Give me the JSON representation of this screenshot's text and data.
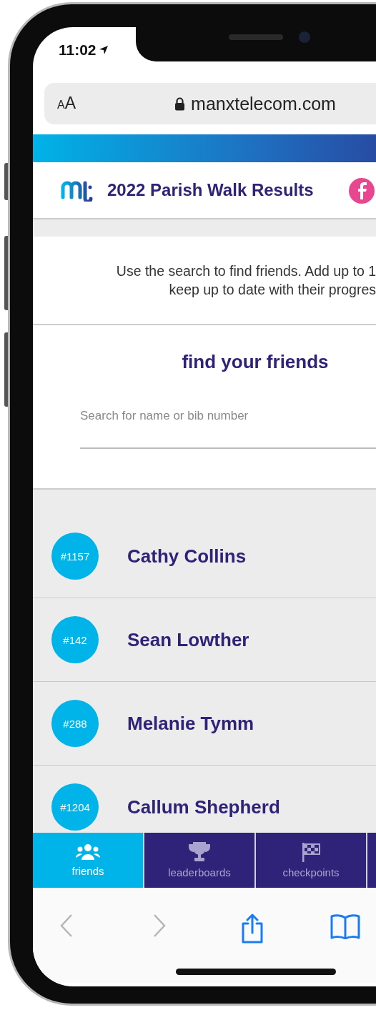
{
  "status_bar": {
    "time": "11:02"
  },
  "address_bar": {
    "text_size": "AA",
    "url": "manxtelecom.com"
  },
  "header": {
    "title": "2022 Parish Walk Results"
  },
  "intro": {
    "text": "Use the search to find friends. Add up to 1\nkeep up to date with their progres"
  },
  "search": {
    "heading": "find your friends",
    "placeholder": "Search for name or bib number"
  },
  "friends": [
    {
      "bib": "#1157",
      "name": "Cathy Collins"
    },
    {
      "bib": "#142",
      "name": "Sean Lowther"
    },
    {
      "bib": "#288",
      "name": "Melanie Tymm"
    },
    {
      "bib": "#1204",
      "name": "Callum Shepherd"
    }
  ],
  "tabs": [
    {
      "kind": "people",
      "label": "friends",
      "selected": true
    },
    {
      "kind": "trophy",
      "label": "leaderboards",
      "selected": false
    },
    {
      "kind": "flag",
      "label": "checkpoints",
      "selected": false
    },
    {
      "kind": "blank",
      "selected": false
    }
  ],
  "browser_toolbar": {
    "back_disabled": true,
    "forward_disabled": true
  }
}
